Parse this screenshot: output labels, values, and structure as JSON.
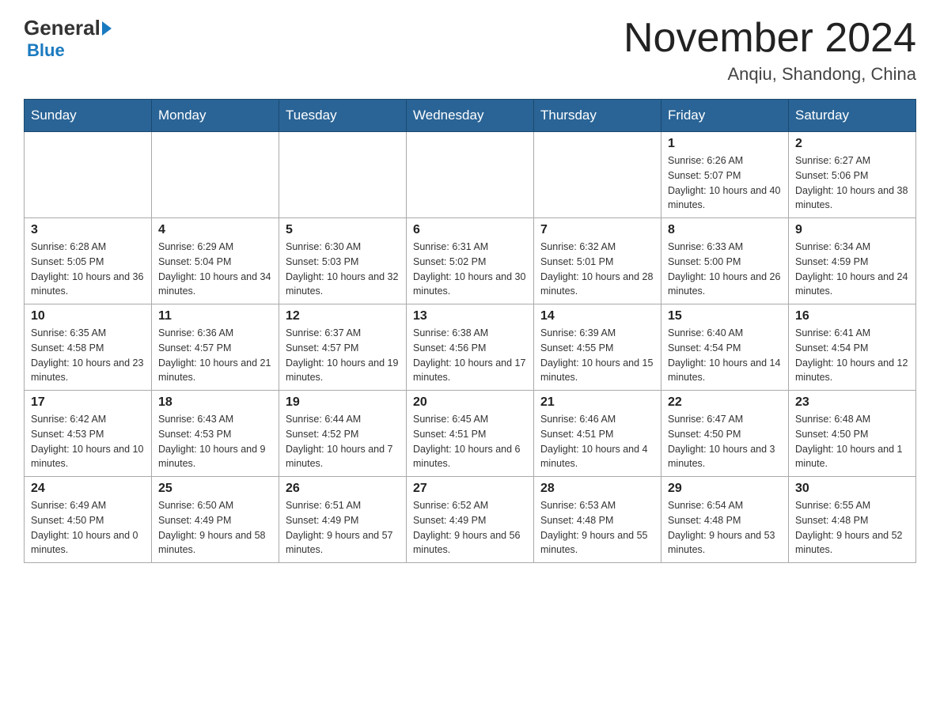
{
  "header": {
    "logo_general": "General",
    "logo_blue": "Blue",
    "month_year": "November 2024",
    "location": "Anqiu, Shandong, China"
  },
  "weekdays": [
    "Sunday",
    "Monday",
    "Tuesday",
    "Wednesday",
    "Thursday",
    "Friday",
    "Saturday"
  ],
  "weeks": [
    [
      {
        "day": "",
        "info": ""
      },
      {
        "day": "",
        "info": ""
      },
      {
        "day": "",
        "info": ""
      },
      {
        "day": "",
        "info": ""
      },
      {
        "day": "",
        "info": ""
      },
      {
        "day": "1",
        "info": "Sunrise: 6:26 AM\nSunset: 5:07 PM\nDaylight: 10 hours and 40 minutes."
      },
      {
        "day": "2",
        "info": "Sunrise: 6:27 AM\nSunset: 5:06 PM\nDaylight: 10 hours and 38 minutes."
      }
    ],
    [
      {
        "day": "3",
        "info": "Sunrise: 6:28 AM\nSunset: 5:05 PM\nDaylight: 10 hours and 36 minutes."
      },
      {
        "day": "4",
        "info": "Sunrise: 6:29 AM\nSunset: 5:04 PM\nDaylight: 10 hours and 34 minutes."
      },
      {
        "day": "5",
        "info": "Sunrise: 6:30 AM\nSunset: 5:03 PM\nDaylight: 10 hours and 32 minutes."
      },
      {
        "day": "6",
        "info": "Sunrise: 6:31 AM\nSunset: 5:02 PM\nDaylight: 10 hours and 30 minutes."
      },
      {
        "day": "7",
        "info": "Sunrise: 6:32 AM\nSunset: 5:01 PM\nDaylight: 10 hours and 28 minutes."
      },
      {
        "day": "8",
        "info": "Sunrise: 6:33 AM\nSunset: 5:00 PM\nDaylight: 10 hours and 26 minutes."
      },
      {
        "day": "9",
        "info": "Sunrise: 6:34 AM\nSunset: 4:59 PM\nDaylight: 10 hours and 24 minutes."
      }
    ],
    [
      {
        "day": "10",
        "info": "Sunrise: 6:35 AM\nSunset: 4:58 PM\nDaylight: 10 hours and 23 minutes."
      },
      {
        "day": "11",
        "info": "Sunrise: 6:36 AM\nSunset: 4:57 PM\nDaylight: 10 hours and 21 minutes."
      },
      {
        "day": "12",
        "info": "Sunrise: 6:37 AM\nSunset: 4:57 PM\nDaylight: 10 hours and 19 minutes."
      },
      {
        "day": "13",
        "info": "Sunrise: 6:38 AM\nSunset: 4:56 PM\nDaylight: 10 hours and 17 minutes."
      },
      {
        "day": "14",
        "info": "Sunrise: 6:39 AM\nSunset: 4:55 PM\nDaylight: 10 hours and 15 minutes."
      },
      {
        "day": "15",
        "info": "Sunrise: 6:40 AM\nSunset: 4:54 PM\nDaylight: 10 hours and 14 minutes."
      },
      {
        "day": "16",
        "info": "Sunrise: 6:41 AM\nSunset: 4:54 PM\nDaylight: 10 hours and 12 minutes."
      }
    ],
    [
      {
        "day": "17",
        "info": "Sunrise: 6:42 AM\nSunset: 4:53 PM\nDaylight: 10 hours and 10 minutes."
      },
      {
        "day": "18",
        "info": "Sunrise: 6:43 AM\nSunset: 4:53 PM\nDaylight: 10 hours and 9 minutes."
      },
      {
        "day": "19",
        "info": "Sunrise: 6:44 AM\nSunset: 4:52 PM\nDaylight: 10 hours and 7 minutes."
      },
      {
        "day": "20",
        "info": "Sunrise: 6:45 AM\nSunset: 4:51 PM\nDaylight: 10 hours and 6 minutes."
      },
      {
        "day": "21",
        "info": "Sunrise: 6:46 AM\nSunset: 4:51 PM\nDaylight: 10 hours and 4 minutes."
      },
      {
        "day": "22",
        "info": "Sunrise: 6:47 AM\nSunset: 4:50 PM\nDaylight: 10 hours and 3 minutes."
      },
      {
        "day": "23",
        "info": "Sunrise: 6:48 AM\nSunset: 4:50 PM\nDaylight: 10 hours and 1 minute."
      }
    ],
    [
      {
        "day": "24",
        "info": "Sunrise: 6:49 AM\nSunset: 4:50 PM\nDaylight: 10 hours and 0 minutes."
      },
      {
        "day": "25",
        "info": "Sunrise: 6:50 AM\nSunset: 4:49 PM\nDaylight: 9 hours and 58 minutes."
      },
      {
        "day": "26",
        "info": "Sunrise: 6:51 AM\nSunset: 4:49 PM\nDaylight: 9 hours and 57 minutes."
      },
      {
        "day": "27",
        "info": "Sunrise: 6:52 AM\nSunset: 4:49 PM\nDaylight: 9 hours and 56 minutes."
      },
      {
        "day": "28",
        "info": "Sunrise: 6:53 AM\nSunset: 4:48 PM\nDaylight: 9 hours and 55 minutes."
      },
      {
        "day": "29",
        "info": "Sunrise: 6:54 AM\nSunset: 4:48 PM\nDaylight: 9 hours and 53 minutes."
      },
      {
        "day": "30",
        "info": "Sunrise: 6:55 AM\nSunset: 4:48 PM\nDaylight: 9 hours and 52 minutes."
      }
    ]
  ]
}
